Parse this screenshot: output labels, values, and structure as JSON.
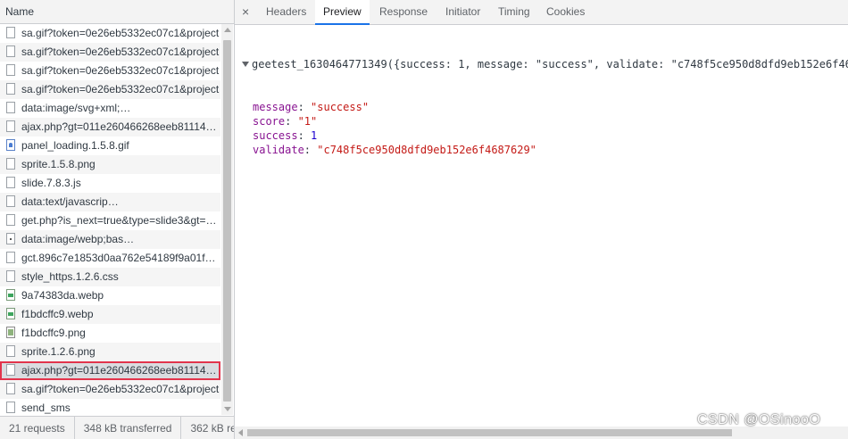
{
  "network": {
    "column_header": "Name",
    "requests": [
      {
        "name": "sa.gif?token=0e26eb5332ec07c1&project",
        "icon": "file-icon"
      },
      {
        "name": "sa.gif?token=0e26eb5332ec07c1&project",
        "icon": "file-icon"
      },
      {
        "name": "sa.gif?token=0e26eb5332ec07c1&project",
        "icon": "file-icon"
      },
      {
        "name": "sa.gif?token=0e26eb5332ec07c1&project",
        "icon": "file-icon"
      },
      {
        "name": "data:image/svg+xml;…",
        "icon": "file-icon"
      },
      {
        "name": "ajax.php?gt=011e260466268eeb81114b…",
        "icon": "file-icon"
      },
      {
        "name": "panel_loading.1.5.8.gif",
        "icon": "gif-icon"
      },
      {
        "name": "sprite.1.5.8.png",
        "icon": "file-icon"
      },
      {
        "name": "slide.7.8.3.js",
        "icon": "file-icon"
      },
      {
        "name": "data:text/javascrip…",
        "icon": "file-icon"
      },
      {
        "name": "get.php?is_next=true&type=slide3&gt=01…",
        "icon": "file-icon"
      },
      {
        "name": "data:image/webp;bas…",
        "icon": "dot-icon"
      },
      {
        "name": "gct.896c7e1853d0aa762e54189f9a01f4f…",
        "icon": "file-icon"
      },
      {
        "name": "style_https.1.2.6.css",
        "icon": "file-icon"
      },
      {
        "name": "9a74383da.webp",
        "icon": "image-icon"
      },
      {
        "name": "f1bdcffc9.webp",
        "icon": "image-icon"
      },
      {
        "name": "f1bdcffc9.png",
        "icon": "png-icon"
      },
      {
        "name": "sprite.1.2.6.png",
        "icon": "file-icon"
      },
      {
        "name": "ajax.php?gt=011e260466268eeb81114b…",
        "icon": "file-icon",
        "selected": true
      },
      {
        "name": "sa.gif?token=0e26eb5332ec07c1&project",
        "icon": "file-icon"
      },
      {
        "name": "send_sms",
        "icon": "file-icon"
      }
    ],
    "status": {
      "requests": "21 requests",
      "transferred": "348 kB transferred",
      "resources": "362 kB re"
    }
  },
  "details": {
    "close_label": "×",
    "tabs": [
      "Headers",
      "Preview",
      "Response",
      "Initiator",
      "Timing",
      "Cookies"
    ],
    "active_tab": "Preview",
    "preview": {
      "summary": "geetest_1630464771349({success: 1, message: \"success\", validate: \"c748f5ce950d8dfd9eb152e6f46",
      "fields": [
        {
          "key": "message",
          "value": "\"success\"",
          "kind": "string"
        },
        {
          "key": "score",
          "value": "\"1\"",
          "kind": "string"
        },
        {
          "key": "success",
          "value": "1",
          "kind": "number"
        },
        {
          "key": "validate",
          "value": "\"c748f5ce950d8dfd9eb152e6f4687629\"",
          "kind": "string"
        }
      ]
    }
  },
  "watermark": "CSDN @OSinooO",
  "colors": {
    "selected_outline": "#e2344c",
    "active_tab_underline": "#1a73e8",
    "json_key": "#881391",
    "json_string": "#c41a16",
    "json_number": "#1c00cf"
  }
}
